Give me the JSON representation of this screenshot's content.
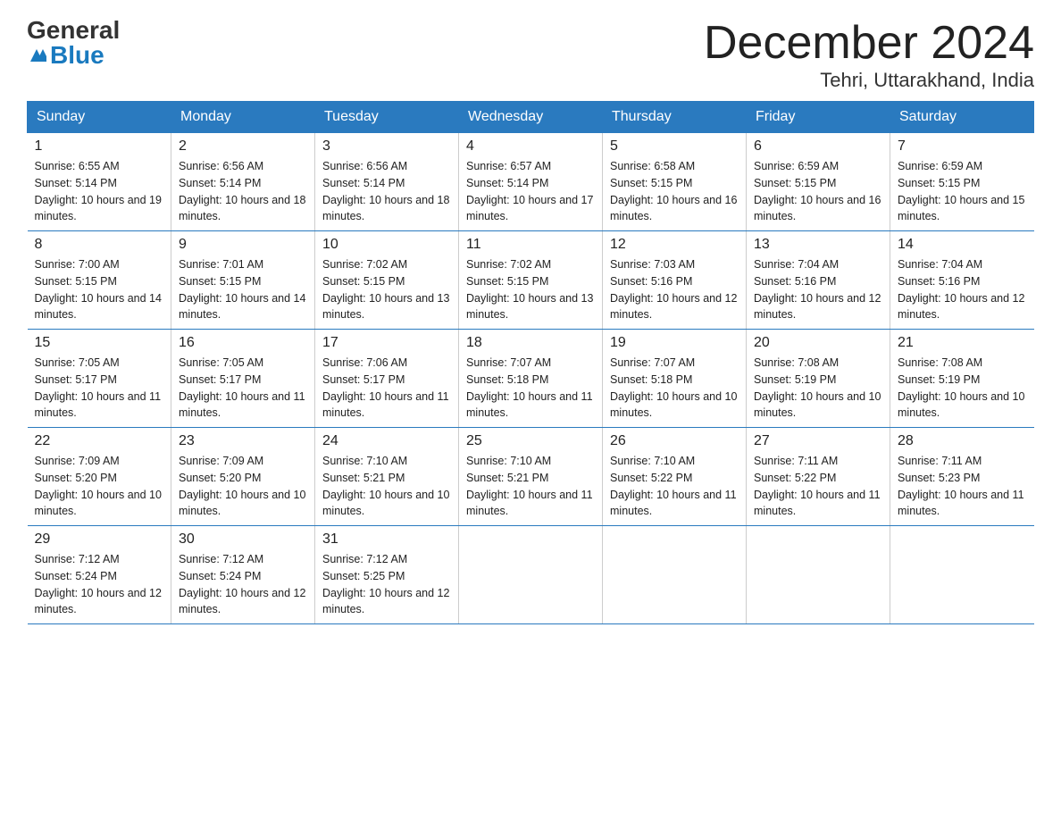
{
  "logo": {
    "general": "General",
    "blue": "Blue"
  },
  "title": "December 2024",
  "subtitle": "Tehri, Uttarakhand, India",
  "days": [
    "Sunday",
    "Monday",
    "Tuesday",
    "Wednesday",
    "Thursday",
    "Friday",
    "Saturday"
  ],
  "weeks": [
    [
      {
        "day": "1",
        "sunrise": "6:55 AM",
        "sunset": "5:14 PM",
        "daylight": "10 hours and 19 minutes."
      },
      {
        "day": "2",
        "sunrise": "6:56 AM",
        "sunset": "5:14 PM",
        "daylight": "10 hours and 18 minutes."
      },
      {
        "day": "3",
        "sunrise": "6:56 AM",
        "sunset": "5:14 PM",
        "daylight": "10 hours and 18 minutes."
      },
      {
        "day": "4",
        "sunrise": "6:57 AM",
        "sunset": "5:14 PM",
        "daylight": "10 hours and 17 minutes."
      },
      {
        "day": "5",
        "sunrise": "6:58 AM",
        "sunset": "5:15 PM",
        "daylight": "10 hours and 16 minutes."
      },
      {
        "day": "6",
        "sunrise": "6:59 AM",
        "sunset": "5:15 PM",
        "daylight": "10 hours and 16 minutes."
      },
      {
        "day": "7",
        "sunrise": "6:59 AM",
        "sunset": "5:15 PM",
        "daylight": "10 hours and 15 minutes."
      }
    ],
    [
      {
        "day": "8",
        "sunrise": "7:00 AM",
        "sunset": "5:15 PM",
        "daylight": "10 hours and 14 minutes."
      },
      {
        "day": "9",
        "sunrise": "7:01 AM",
        "sunset": "5:15 PM",
        "daylight": "10 hours and 14 minutes."
      },
      {
        "day": "10",
        "sunrise": "7:02 AM",
        "sunset": "5:15 PM",
        "daylight": "10 hours and 13 minutes."
      },
      {
        "day": "11",
        "sunrise": "7:02 AM",
        "sunset": "5:15 PM",
        "daylight": "10 hours and 13 minutes."
      },
      {
        "day": "12",
        "sunrise": "7:03 AM",
        "sunset": "5:16 PM",
        "daylight": "10 hours and 12 minutes."
      },
      {
        "day": "13",
        "sunrise": "7:04 AM",
        "sunset": "5:16 PM",
        "daylight": "10 hours and 12 minutes."
      },
      {
        "day": "14",
        "sunrise": "7:04 AM",
        "sunset": "5:16 PM",
        "daylight": "10 hours and 12 minutes."
      }
    ],
    [
      {
        "day": "15",
        "sunrise": "7:05 AM",
        "sunset": "5:17 PM",
        "daylight": "10 hours and 11 minutes."
      },
      {
        "day": "16",
        "sunrise": "7:05 AM",
        "sunset": "5:17 PM",
        "daylight": "10 hours and 11 minutes."
      },
      {
        "day": "17",
        "sunrise": "7:06 AM",
        "sunset": "5:17 PM",
        "daylight": "10 hours and 11 minutes."
      },
      {
        "day": "18",
        "sunrise": "7:07 AM",
        "sunset": "5:18 PM",
        "daylight": "10 hours and 11 minutes."
      },
      {
        "day": "19",
        "sunrise": "7:07 AM",
        "sunset": "5:18 PM",
        "daylight": "10 hours and 10 minutes."
      },
      {
        "day": "20",
        "sunrise": "7:08 AM",
        "sunset": "5:19 PM",
        "daylight": "10 hours and 10 minutes."
      },
      {
        "day": "21",
        "sunrise": "7:08 AM",
        "sunset": "5:19 PM",
        "daylight": "10 hours and 10 minutes."
      }
    ],
    [
      {
        "day": "22",
        "sunrise": "7:09 AM",
        "sunset": "5:20 PM",
        "daylight": "10 hours and 10 minutes."
      },
      {
        "day": "23",
        "sunrise": "7:09 AM",
        "sunset": "5:20 PM",
        "daylight": "10 hours and 10 minutes."
      },
      {
        "day": "24",
        "sunrise": "7:10 AM",
        "sunset": "5:21 PM",
        "daylight": "10 hours and 10 minutes."
      },
      {
        "day": "25",
        "sunrise": "7:10 AM",
        "sunset": "5:21 PM",
        "daylight": "10 hours and 11 minutes."
      },
      {
        "day": "26",
        "sunrise": "7:10 AM",
        "sunset": "5:22 PM",
        "daylight": "10 hours and 11 minutes."
      },
      {
        "day": "27",
        "sunrise": "7:11 AM",
        "sunset": "5:22 PM",
        "daylight": "10 hours and 11 minutes."
      },
      {
        "day": "28",
        "sunrise": "7:11 AM",
        "sunset": "5:23 PM",
        "daylight": "10 hours and 11 minutes."
      }
    ],
    [
      {
        "day": "29",
        "sunrise": "7:12 AM",
        "sunset": "5:24 PM",
        "daylight": "10 hours and 12 minutes."
      },
      {
        "day": "30",
        "sunrise": "7:12 AM",
        "sunset": "5:24 PM",
        "daylight": "10 hours and 12 minutes."
      },
      {
        "day": "31",
        "sunrise": "7:12 AM",
        "sunset": "5:25 PM",
        "daylight": "10 hours and 12 minutes."
      },
      null,
      null,
      null,
      null
    ]
  ],
  "labels": {
    "sunrise": "Sunrise:",
    "sunset": "Sunset:",
    "daylight": "Daylight:"
  }
}
